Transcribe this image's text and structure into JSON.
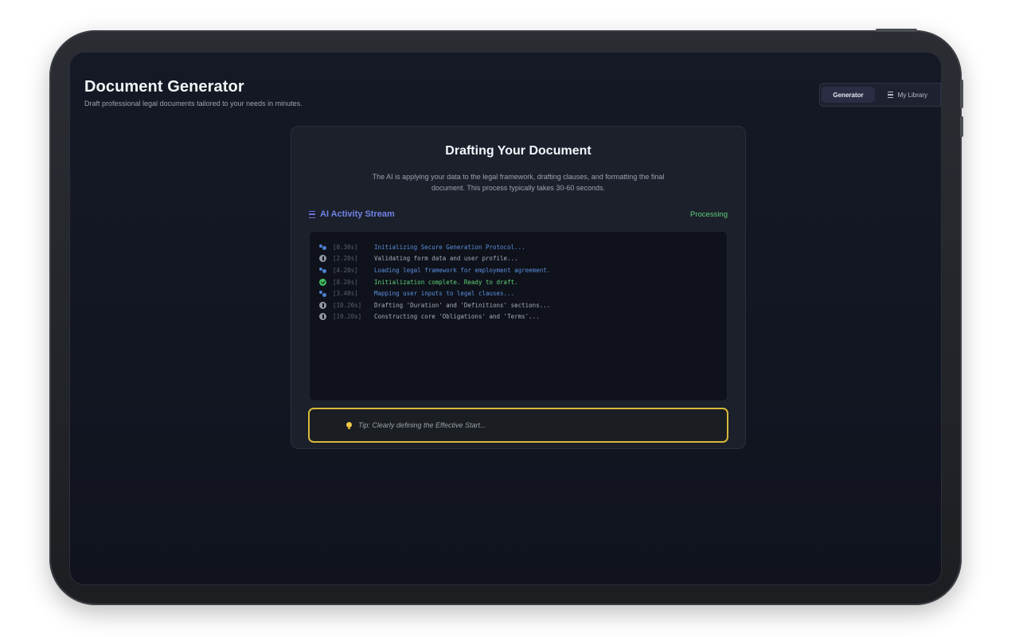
{
  "app": {
    "title": "Document Generator",
    "subtitle": "Draft professional legal documents tailored to your needs in minutes."
  },
  "nav": {
    "generator_label": "Generator",
    "library_label": "My Library",
    "active": "Generator"
  },
  "card": {
    "title": "Drafting Your Document",
    "description": "The AI is applying your data to the legal framework, drafting clauses, and formatting the final document. This process typically takes 30-60 seconds."
  },
  "stream": {
    "title": "AI Activity Stream",
    "status": "Processing",
    "logs": [
      {
        "icon": "processing-icon",
        "time": "[0.30s]",
        "message": "Initializing Secure Generation Protocol...",
        "color": "blue"
      },
      {
        "icon": "info-icon",
        "time": "[2.20s]",
        "message": "Validating form data and user profile...",
        "color": "gray"
      },
      {
        "icon": "processing-icon",
        "time": "[4.20s]",
        "message": "Loading legal framework for employment agreement.",
        "color": "blue"
      },
      {
        "icon": "check-icon",
        "time": "[8.20s]",
        "message": "Initialization complete. Ready to draft.",
        "color": "green"
      },
      {
        "icon": "processing-icon",
        "time": "[3.40s]",
        "message": "Mapping user inputs to legal clauses...",
        "color": "blue"
      },
      {
        "icon": "info-icon",
        "time": "[10.20s]",
        "message": "Drafting 'Duration' and 'Definitions' sections...",
        "color": "gray"
      },
      {
        "icon": "info-icon",
        "time": "[19.20s]",
        "message": "Constructing core 'Obligations' and 'Terms'...",
        "color": "gray"
      }
    ]
  },
  "tip": {
    "text": "Tip: Clearly defining the Effective Start..."
  },
  "colors": {
    "accent": "#6a6fe0",
    "success": "#5fcf7a",
    "tip_border": "#d6b93a"
  }
}
